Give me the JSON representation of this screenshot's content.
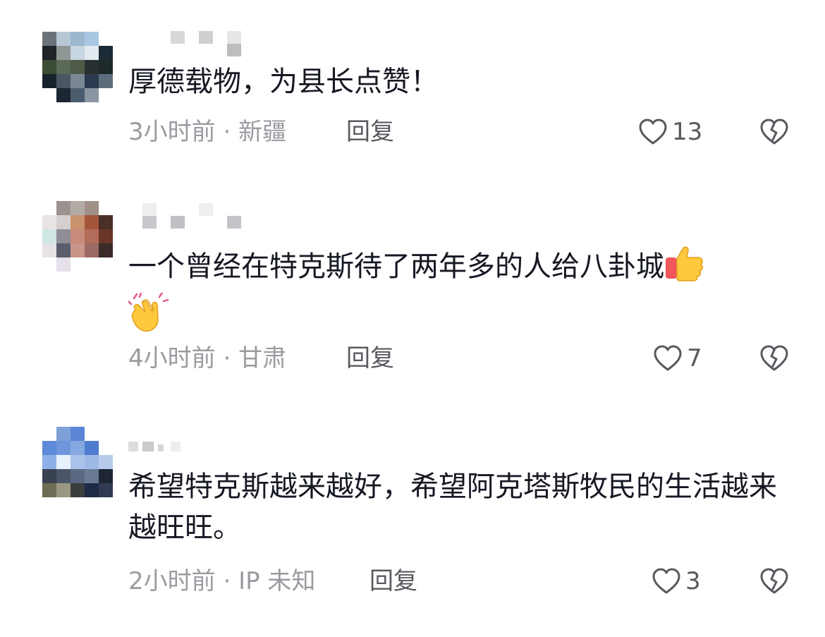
{
  "comments": [
    {
      "text": "厚德载物，为县长点赞！",
      "time": "3小时前",
      "location": "新疆",
      "reply_label": "回复",
      "likes": "13"
    },
    {
      "text": "一个曾经在特克斯待了两年多的人给八卦城",
      "emoji_1": "thumbs-up",
      "emoji_2": "clapping-hands",
      "time": "4小时前",
      "location": "甘肃",
      "reply_label": "回复",
      "likes": "7"
    },
    {
      "text": "希望特克斯越来越好，希望阿克塔斯牧民的生活越来越旺旺。",
      "time": "2小时前",
      "location": "IP 未知",
      "reply_label": "回复",
      "likes": "3"
    }
  ],
  "meta_separator": " · ",
  "icons": {
    "like": "heart-outline-icon",
    "dislike": "broken-heart-icon"
  },
  "colors": {
    "text": "#161823",
    "meta": "#9a9ba1",
    "action": "#58595f"
  }
}
